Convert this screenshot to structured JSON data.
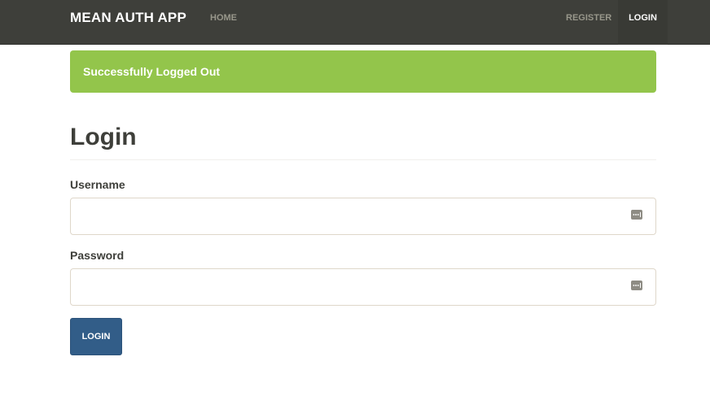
{
  "navbar": {
    "brand": "MEAN AUTH APP",
    "links": [
      {
        "label": "HOME"
      },
      {
        "label": "REGISTER"
      },
      {
        "label": "LOGIN",
        "active": true
      }
    ]
  },
  "alert": {
    "message": "Successfully Logged Out",
    "color": "#93c54b"
  },
  "form": {
    "title": "Login",
    "username": {
      "label": "Username",
      "value": "",
      "icon": "password-manager-icon"
    },
    "password": {
      "label": "Password",
      "value": "",
      "icon": "password-manager-icon"
    },
    "submit_label": "LOGIN"
  },
  "colors": {
    "navbar": "#3e3f3a",
    "primary_button": "#325d88",
    "success": "#93c54b"
  }
}
